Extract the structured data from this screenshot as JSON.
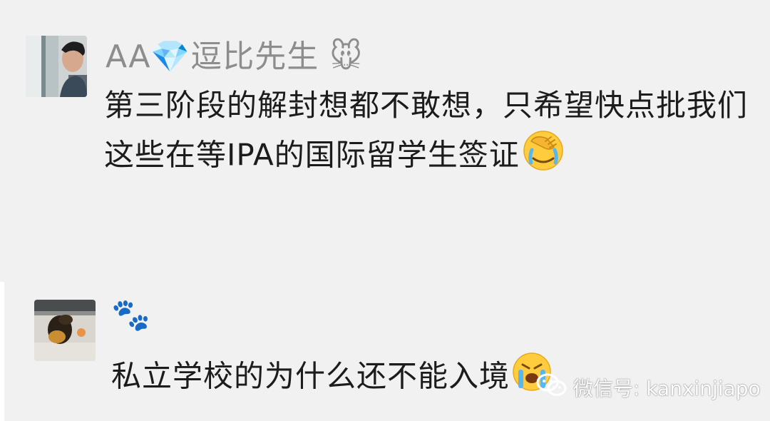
{
  "comments": [
    {
      "username": "AA💎逗比先生 🐭",
      "message": "第三阶段的解封想都不敢想，只希望快点批我们这些在等IPA的国际留学生签证",
      "trailing_emoji": "facepalm-crying-emoji"
    },
    {
      "username": "🐾",
      "message": "私立学校的为什么还不能入境",
      "trailing_emoji": "crying-face-emoji"
    }
  ],
  "watermark": {
    "label": "微信号: kanxinjiapo",
    "icon": "wechat-icon"
  },
  "colors": {
    "background": "#f1f1f1",
    "username": "#8d8d8d",
    "message": "#1c1c1c"
  }
}
